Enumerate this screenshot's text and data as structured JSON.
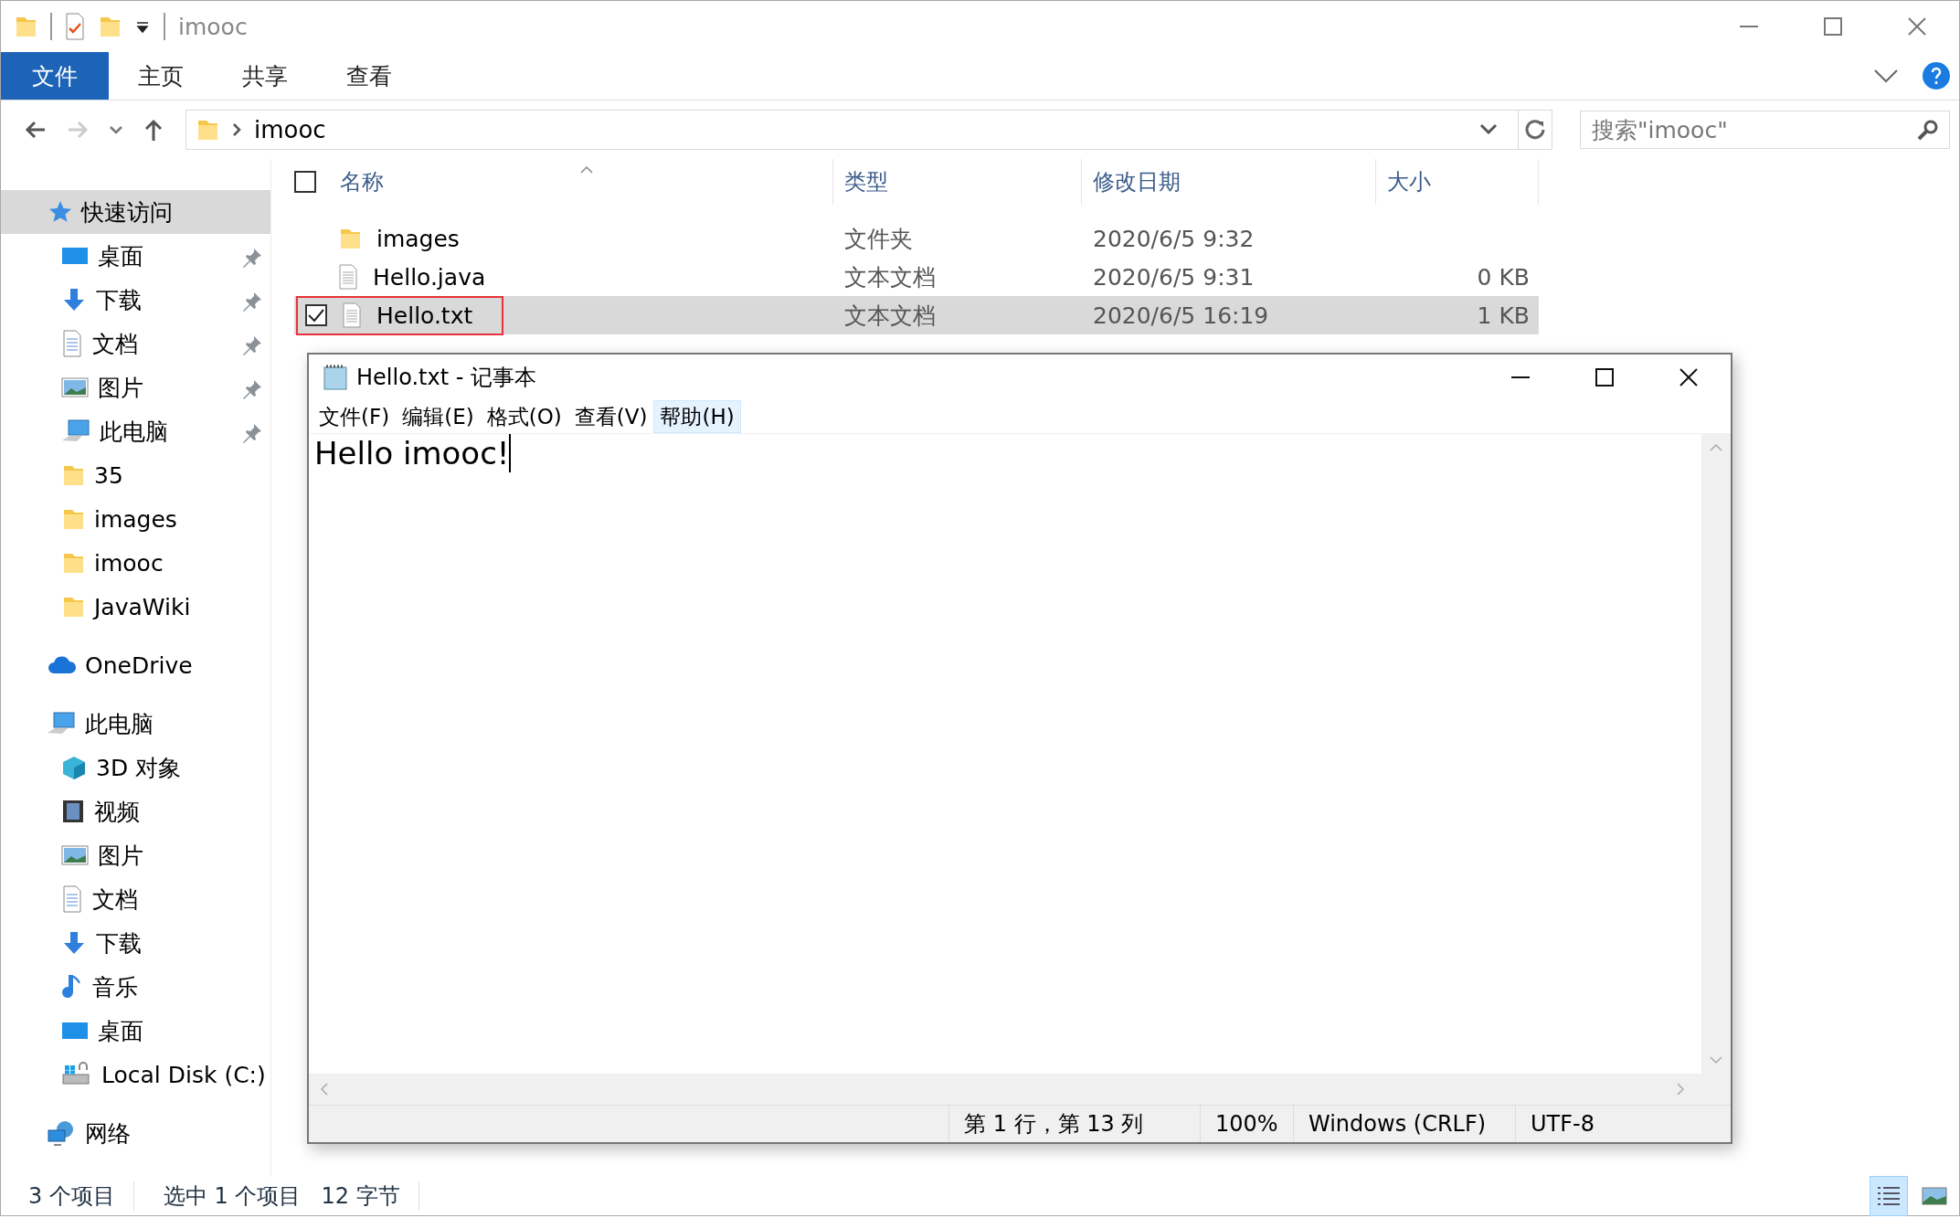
{
  "window": {
    "title": "imooc"
  },
  "ribbon_tabs": [
    {
      "label": "文件",
      "selected": true
    },
    {
      "label": "主页",
      "selected": false
    },
    {
      "label": "共享",
      "selected": false
    },
    {
      "label": "查看",
      "selected": false
    }
  ],
  "address_bar": {
    "path": "imooc"
  },
  "search": {
    "placeholder": "搜索\"imooc\""
  },
  "sidebar": {
    "sections": [
      {
        "label": "快速访问",
        "kind": "star",
        "selected": true,
        "children": [
          {
            "label": "桌面",
            "kind": "desktop",
            "pinned": true
          },
          {
            "label": "下载",
            "kind": "download",
            "pinned": true
          },
          {
            "label": "文档",
            "kind": "document",
            "pinned": true
          },
          {
            "label": "图片",
            "kind": "picture",
            "pinned": true
          },
          {
            "label": "此电脑",
            "kind": "pc",
            "pinned": true
          },
          {
            "label": "35",
            "kind": "folder",
            "pinned": false
          },
          {
            "label": "images",
            "kind": "folder",
            "pinned": false
          },
          {
            "label": "imooc",
            "kind": "folder",
            "pinned": false
          },
          {
            "label": "JavaWiki",
            "kind": "folder",
            "pinned": false
          }
        ]
      },
      {
        "label": "OneDrive",
        "kind": "cloud",
        "selected": false
      },
      {
        "label": "此电脑",
        "kind": "pc",
        "selected": false,
        "children": [
          {
            "label": "3D 对象",
            "kind": "cube",
            "pinned": false
          },
          {
            "label": "视频",
            "kind": "video",
            "pinned": false
          },
          {
            "label": "图片",
            "kind": "picture",
            "pinned": false
          },
          {
            "label": "文档",
            "kind": "document",
            "pinned": false
          },
          {
            "label": "下载",
            "kind": "download",
            "pinned": false
          },
          {
            "label": "音乐",
            "kind": "music",
            "pinned": false
          },
          {
            "label": "桌面",
            "kind": "desktop",
            "pinned": false
          },
          {
            "label": "Local Disk (C:)",
            "kind": "disk",
            "pinned": false
          }
        ]
      },
      {
        "label": "网络",
        "kind": "network",
        "selected": false
      }
    ]
  },
  "file_list": {
    "columns": [
      "名称",
      "类型",
      "修改日期",
      "大小"
    ],
    "select_all_checked": false,
    "rows": [
      {
        "name": "images",
        "kind": "folder",
        "type": "文件夹",
        "modified": "2020/6/5 9:32",
        "selected": false
      },
      {
        "name": "Hello.java",
        "kind": "file",
        "type": "文本文档",
        "modified": "2020/6/5 9:31",
        "size": "0 KB",
        "selected": false
      },
      {
        "name": "Hello.txt",
        "kind": "file",
        "type": "文本文档",
        "modified": "2020/6/5 16:19",
        "size": "1 KB",
        "selected": true
      }
    ]
  },
  "notepad": {
    "title": "Hello.txt - 记事本",
    "menu": [
      {
        "label": "文件(F)",
        "selected": false
      },
      {
        "label": "编辑(E)",
        "selected": false
      },
      {
        "label": "格式(O)",
        "selected": false
      },
      {
        "label": "查看(V)",
        "selected": false
      },
      {
        "label": "帮助(H)",
        "selected": true
      }
    ],
    "content": "Hello imooc!",
    "status": [
      "第 1 行，第 13 列",
      "100%",
      "Windows (CRLF)",
      "UTF-8"
    ]
  },
  "status_bar": {
    "item_count": "3 个项目",
    "selection": "选中 1 个项目",
    "selection_size": "12 字节"
  },
  "view_buttons": [
    {
      "kind": "details",
      "selected": true
    },
    {
      "kind": "tiles",
      "selected": false
    }
  ]
}
